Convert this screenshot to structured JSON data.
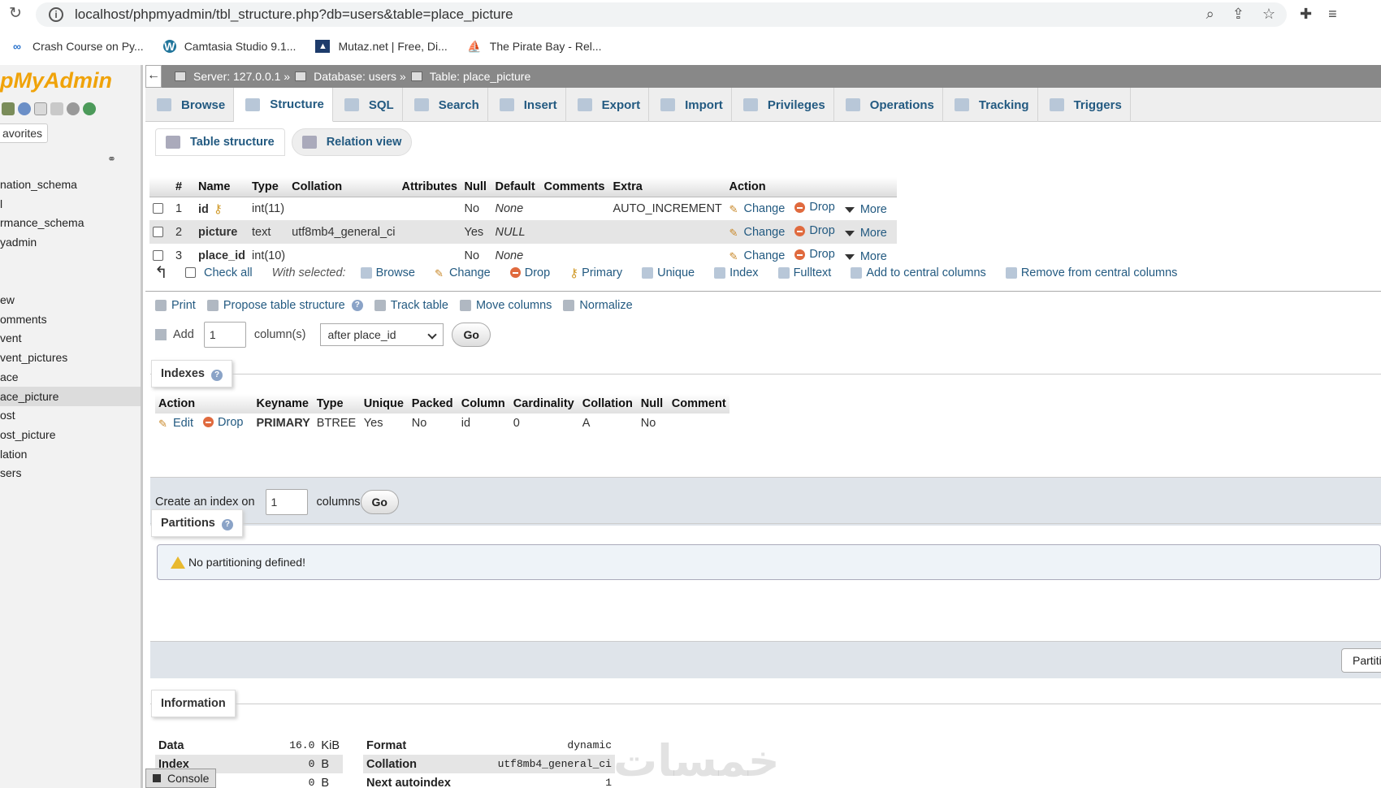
{
  "browser": {
    "url": "localhost/phpmyadmin/tbl_structure.php?db=users&table=place_picture",
    "bookmarks": [
      {
        "label": "Crash Course on Py...",
        "icon": "coursera-icon"
      },
      {
        "label": "Camtasia Studio 9.1...",
        "icon": "wordpress-icon"
      },
      {
        "label": "Mutaz.net | Free, Di...",
        "icon": "mountain-icon"
      },
      {
        "label": "The Pirate Bay - Rel...",
        "icon": "pirate-ship-icon"
      }
    ]
  },
  "sidebar": {
    "logo": "pMyAdmin",
    "favorites": "avorites",
    "databases": [
      "nation_schema",
      "l",
      "rmance_schema",
      "yadmin"
    ],
    "tables": [
      "ew",
      "omments",
      "vent",
      "vent_pictures",
      "ace",
      "ace_picture",
      "ost",
      "ost_picture",
      "lation",
      "sers"
    ],
    "active_table": "ace_picture"
  },
  "breadcrumb": {
    "server": "Server: 127.0.0.1 »",
    "database": "Database: users »",
    "table": "Table: place_picture"
  },
  "tabs": [
    "Browse",
    "Structure",
    "SQL",
    "Search",
    "Insert",
    "Export",
    "Import",
    "Privileges",
    "Operations",
    "Tracking",
    "Triggers"
  ],
  "active_tab": "Structure",
  "subtabs": [
    "Table structure",
    "Relation view"
  ],
  "structure": {
    "headers": [
      "#",
      "Name",
      "Type",
      "Collation",
      "Attributes",
      "Null",
      "Default",
      "Comments",
      "Extra",
      "Action"
    ],
    "rows": [
      {
        "num": "1",
        "name": "id",
        "type": "int(11)",
        "collation": "",
        "attributes": "",
        "null": "No",
        "default": "None",
        "comments": "",
        "extra": "AUTO_INCREMENT"
      },
      {
        "num": "2",
        "name": "picture",
        "type": "text",
        "collation": "utf8mb4_general_ci",
        "attributes": "",
        "null": "Yes",
        "default": "NULL",
        "comments": "",
        "extra": ""
      },
      {
        "num": "3",
        "name": "place_id",
        "type": "int(10)",
        "collation": "",
        "attributes": "",
        "null": "No",
        "default": "None",
        "comments": "",
        "extra": ""
      }
    ],
    "actions": {
      "change": "Change",
      "drop": "Drop",
      "more": "More"
    }
  },
  "with_selected": {
    "check_all": "Check all",
    "label": "With selected:",
    "items": [
      "Browse",
      "Change",
      "Drop",
      "Primary",
      "Unique",
      "Index",
      "Fulltext",
      "Add to central columns",
      "Remove from central columns"
    ]
  },
  "ops": [
    "Print",
    "Propose table structure",
    "Track table",
    "Move columns",
    "Normalize"
  ],
  "add": {
    "label": "Add",
    "value": "1",
    "columns_label": "column(s)",
    "position": "after place_id",
    "go": "Go"
  },
  "indexes": {
    "legend": "Indexes",
    "headers": [
      "Action",
      "Keyname",
      "Type",
      "Unique",
      "Packed",
      "Column",
      "Cardinality",
      "Collation",
      "Null",
      "Comment"
    ],
    "row": {
      "edit": "Edit",
      "drop": "Drop",
      "keyname": "PRIMARY",
      "type": "BTREE",
      "unique": "Yes",
      "packed": "No",
      "column": "id",
      "cardinality": "0",
      "collation": "A",
      "null": "No",
      "comment": ""
    },
    "create_label": "Create an index on",
    "create_value": "1",
    "columns_label": "columns",
    "go": "Go"
  },
  "partitions": {
    "legend": "Partitions",
    "notice": "No partitioning defined!",
    "button": "Partiti"
  },
  "information": {
    "legend": "Information",
    "space": [
      {
        "label": "Data",
        "value": "16.0",
        "unit": "KiB"
      },
      {
        "label": "Index",
        "value": "0",
        "unit": "B"
      },
      {
        "label": "",
        "value": "0",
        "unit": "B"
      }
    ],
    "row_stats": [
      {
        "label": "Format",
        "value": "dynamic"
      },
      {
        "label": "Collation",
        "value": "utf8mb4_general_ci"
      },
      {
        "label": "Next autoindex",
        "value": "1"
      }
    ]
  },
  "console": "Console",
  "watermark": "خمسات"
}
